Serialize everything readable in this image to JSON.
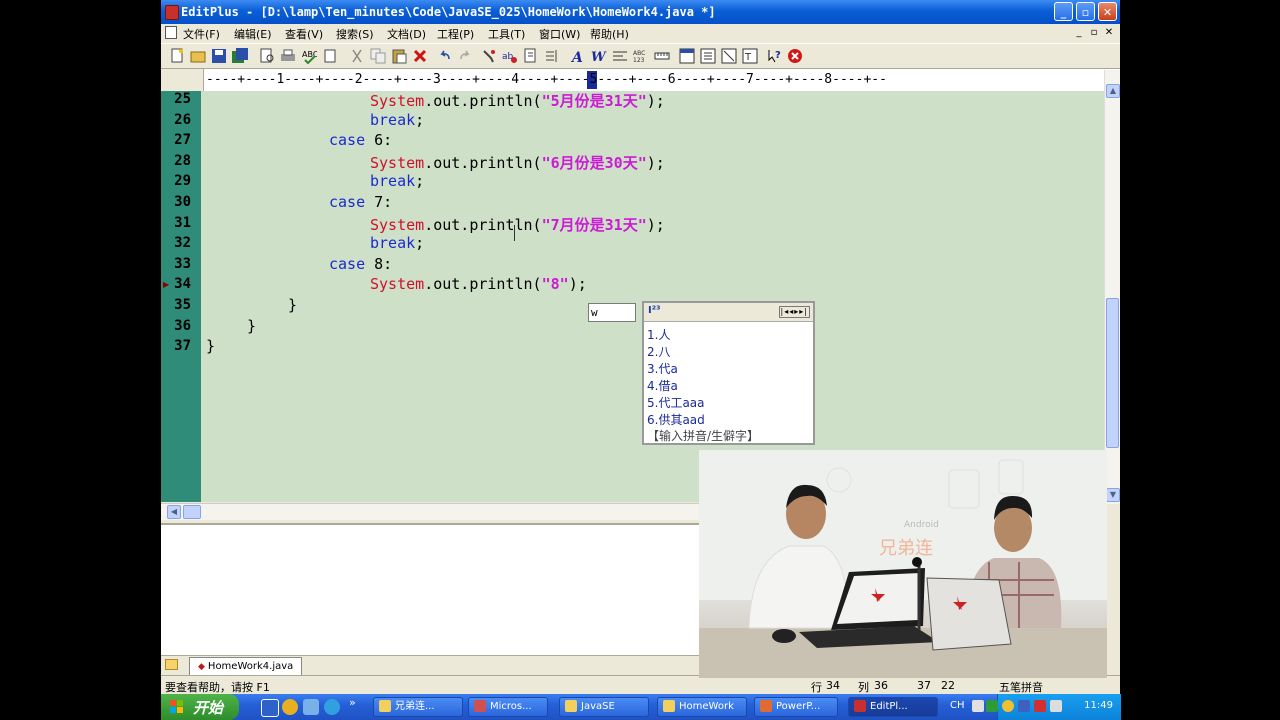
{
  "window": {
    "title": "EditPlus - [D:\\lamp\\Ten_minutes\\Code\\JavaSE_025\\HomeWork\\HomeWork4.java *]",
    "minimize": "_",
    "maximize": "▫",
    "close": "✕"
  },
  "menu": [
    "文件(F)",
    "编辑(E)",
    "查看(V)",
    "搜索(S)",
    "文档(D)",
    "工程(P)",
    "工具(T)",
    "窗口(W)",
    "帮助(H)"
  ],
  "mdi_controls": [
    "_",
    "▫",
    "✕"
  ],
  "ruler": "----+----1----+----2----+----3----+----4----+----5----+----6----+----7----+----8----+--",
  "editor": {
    "lines": [
      {
        "n": "25",
        "indent": "        ",
        "cls": "System",
        "mid": ".out.println(",
        "str": "\"5月份是31天\"",
        "end": ");"
      },
      {
        "n": "26",
        "indent": "        ",
        "kw": "break",
        "end": ";"
      },
      {
        "n": "27",
        "indent": "      ",
        "kw": "case",
        "end": " 6:"
      },
      {
        "n": "28",
        "indent": "        ",
        "cls": "System",
        "mid": ".out.println(",
        "str": "\"6月份是30天\"",
        "end": ");"
      },
      {
        "n": "29",
        "indent": "        ",
        "kw": "break",
        "end": ";"
      },
      {
        "n": "30",
        "indent": "      ",
        "kw": "case",
        "end": " 7:"
      },
      {
        "n": "31",
        "indent": "        ",
        "cls": "System",
        "mid": ".out.println(",
        "str": "\"7月份是31天\"",
        "end": ");"
      },
      {
        "n": "32",
        "indent": "        ",
        "kw": "break",
        "end": ";"
      },
      {
        "n": "33",
        "indent": "      ",
        "kw": "case",
        "end": " 8:"
      },
      {
        "n": "34",
        "indent": "        ",
        "cls": "System",
        "mid": ".out.println(",
        "str": "\"8\"",
        "end": ");"
      },
      {
        "n": "35",
        "indent": "    ",
        "end": "}"
      },
      {
        "n": "36",
        "indent": "  ",
        "end": "}"
      },
      {
        "n": "37",
        "indent": "",
        "end": "}"
      }
    ],
    "current_line": "34"
  },
  "ime": {
    "input": "w",
    "logo": "I²³",
    "nav": "|◂◂▸▸|",
    "candidates": [
      "1.人",
      "2.八",
      "3.代a",
      "4.借a",
      "5.代工aaa",
      "6.供其aad"
    ],
    "hint": "【输入拼音/生僻字】"
  },
  "tabs": [
    {
      "label": "HomeWork4.java"
    }
  ],
  "status": {
    "help": "要查看帮助，请按 F1",
    "row_label": "行",
    "row": "34",
    "col_label": "列",
    "col": "36",
    "a": "37",
    "b": "22",
    "ime_name": "五笔拼音"
  },
  "video": {
    "watermark": "兄弟连",
    "watermark_sub": "Android"
  },
  "taskbar": {
    "start": "开始",
    "buttons": [
      "兄弟连...",
      "Micros...",
      "JavaSE",
      "HomeWork",
      "PowerP...",
      "EditPl..."
    ],
    "lang": "CH",
    "clock": "11:49"
  },
  "colors": {
    "editor_bg": "#cfe0c8",
    "gutter_bg": "#2f8c78",
    "keyword": "#1a2ad0",
    "class": "#d0102a",
    "string": "#cc1ad6",
    "titlebar": "#0a5fd6"
  }
}
